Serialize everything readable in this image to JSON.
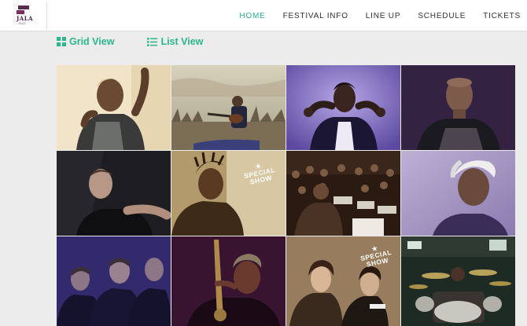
{
  "nav": {
    "logo_text": "JALA",
    "logo_sub": "JAZZ",
    "items": [
      {
        "label": "HOME",
        "active": true
      },
      {
        "label": "FESTIVAL INFO",
        "active": false
      },
      {
        "label": "LINE UP",
        "active": false
      },
      {
        "label": "SCHEDULE",
        "active": false
      },
      {
        "label": "TICKETS",
        "active": false
      }
    ]
  },
  "view_toggle": {
    "grid_label": "Grid View",
    "list_label": "List View",
    "grid_icon": "grid-icon",
    "list_icon": "list-icon",
    "accent": "#2ab78e"
  },
  "artists": [
    {
      "id": "artist-1",
      "style": "warm",
      "badge": null
    },
    {
      "id": "artist-2",
      "style": "landscape",
      "badge": null
    },
    {
      "id": "artist-3",
      "style": "purple",
      "badge": null
    },
    {
      "id": "artist-4",
      "style": "dark-purple",
      "badge": null
    },
    {
      "id": "artist-5",
      "style": "dark",
      "badge": null
    },
    {
      "id": "artist-6",
      "style": "sepia",
      "badge": {
        "line1": "SPECIAL",
        "line2": "SHOW"
      }
    },
    {
      "id": "artist-7",
      "style": "orchestra",
      "badge": null
    },
    {
      "id": "artist-8",
      "style": "lilac",
      "badge": null
    },
    {
      "id": "artist-9",
      "style": "indigo-trio",
      "badge": null
    },
    {
      "id": "artist-10",
      "style": "saxophone",
      "badge": null
    },
    {
      "id": "artist-11",
      "style": "duo",
      "badge": {
        "line1": "SPECIAL",
        "line2": "SHOW"
      }
    },
    {
      "id": "artist-12",
      "style": "drums",
      "badge": null
    }
  ]
}
